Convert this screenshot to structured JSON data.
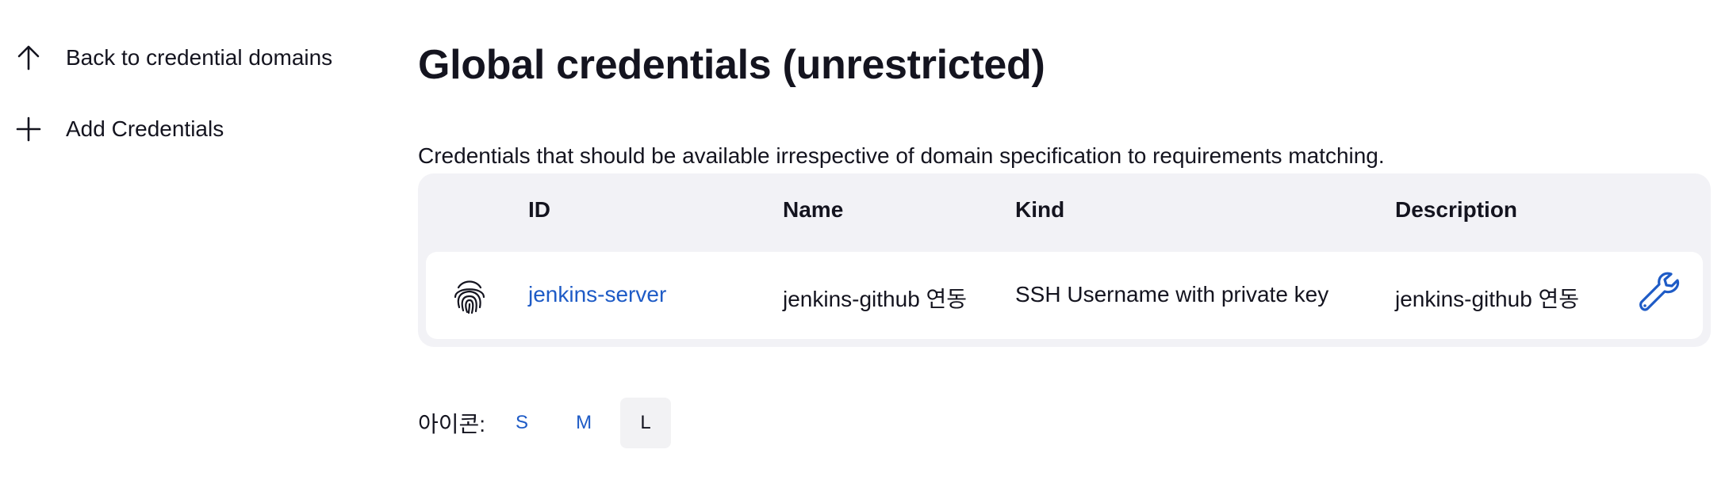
{
  "sidebar": {
    "back_label": "Back to credential domains",
    "add_label": "Add Credentials"
  },
  "main": {
    "title": "Global credentials (unrestricted)",
    "description": "Credentials that should be available irrespective of domain specification to requirements matching."
  },
  "table": {
    "headers": [
      "ID",
      "Name",
      "Kind",
      "Description"
    ],
    "rows": [
      {
        "icon": "fingerprint-icon",
        "id": "jenkins-server",
        "name": "jenkins-github 연동",
        "kind": "SSH Username with private key",
        "description": "jenkins-github 연동",
        "action_icon": "wrench-icon"
      }
    ]
  },
  "icon_size": {
    "label": "아이콘:",
    "options": [
      "S",
      "M",
      "L"
    ],
    "selected": "L"
  },
  "colors": {
    "link": "#1e5bc6",
    "table_bg": "#f2f2f6",
    "text": "#14141f"
  }
}
